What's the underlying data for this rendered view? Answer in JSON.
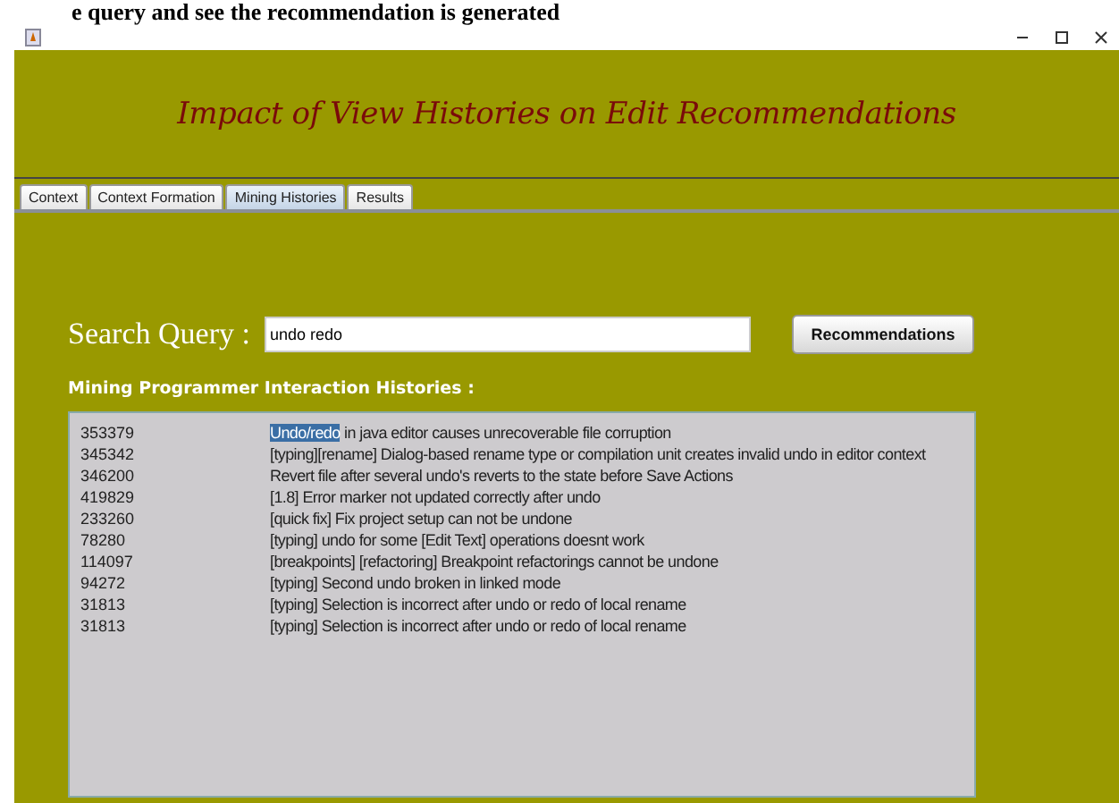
{
  "caption": "e query and see the recommendation is generated",
  "window": {
    "title": "Impact of View Histories on Edit Recommendations"
  },
  "tabs": [
    {
      "label": "Context",
      "selected": false
    },
    {
      "label": "Context Formation",
      "selected": false
    },
    {
      "label": "Mining Histories",
      "selected": true
    },
    {
      "label": "Results",
      "selected": false
    }
  ],
  "search": {
    "label": "Search Query :",
    "value": "undo redo",
    "button": "Recommendations"
  },
  "histories": {
    "heading": "Mining Programmer Interaction Histories :",
    "rows": [
      {
        "id": "353379",
        "highlight": "Undo/redo",
        "text": " in java editor causes unrecoverable file corruption"
      },
      {
        "id": "345342",
        "text": "[typing][rename] Dialog-based rename type or compilation unit creates invalid undo in editor context"
      },
      {
        "id": "346200",
        "text": "Revert file after several undo's reverts to the state before Save Actions"
      },
      {
        "id": "419829",
        "text": "[1.8] Error marker not updated correctly after undo"
      },
      {
        "id": "233260",
        "text": "[quick fix] Fix project setup can not be undone"
      },
      {
        "id": "78280",
        "text": "[typing] undo for some [Edit Text] operations doesnt work"
      },
      {
        "id": "114097",
        "text": "[breakpoints] [refactoring] Breakpoint refactorings cannot be undone"
      },
      {
        "id": "94272",
        "text": "[typing] Second undo broken in linked mode"
      },
      {
        "id": "31813",
        "text": "[typing] Selection is incorrect after undo or redo of local rename"
      },
      {
        "id": "31813",
        "text": "[typing] Selection is incorrect after undo or redo of local rename"
      }
    ]
  }
}
